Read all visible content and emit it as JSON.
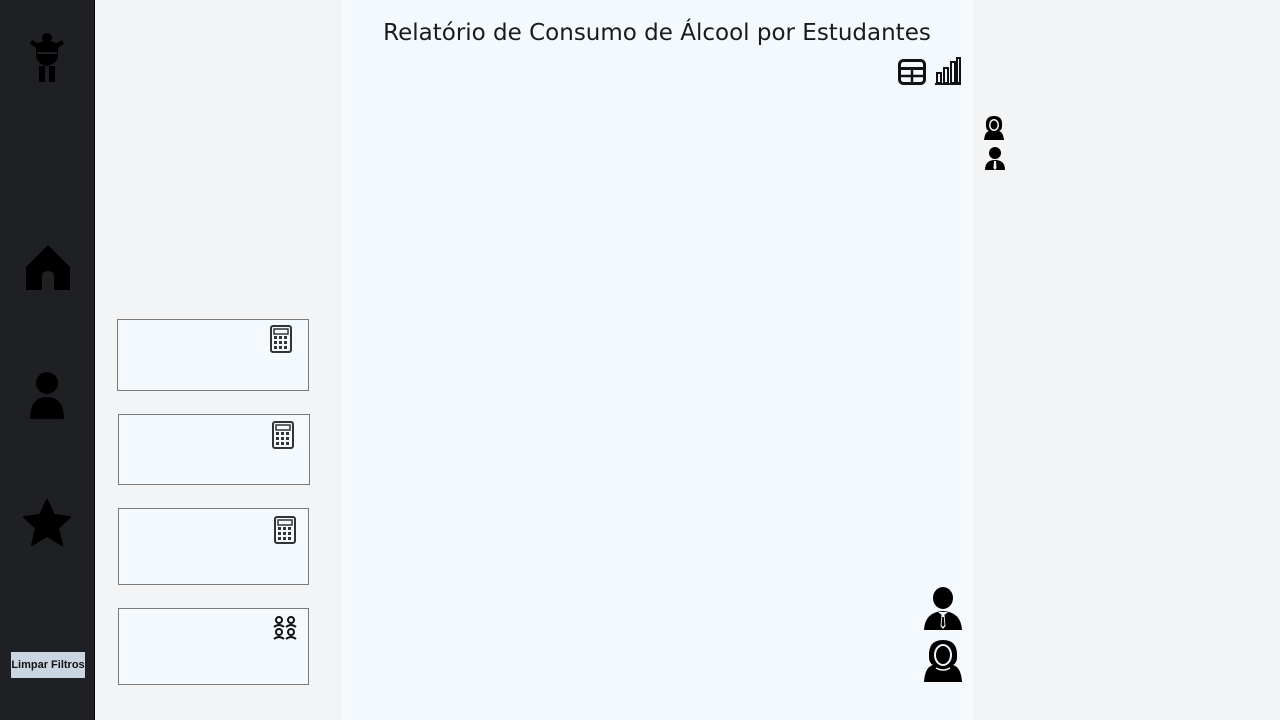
{
  "report": {
    "title": "Relatório de Consumo de Álcool por Estudantes"
  },
  "sidebar": {
    "icons": [
      "logo-icon",
      "home-icon",
      "person-icon",
      "star-icon"
    ],
    "clear_filters_label": "Limpar Filtros"
  },
  "toolbar": {
    "icons": [
      "table-icon",
      "bar-chart-icon"
    ]
  },
  "cards": [
    {
      "icon": "calculator-icon"
    },
    {
      "icon": "calculator-icon"
    },
    {
      "icon": "calculator-icon"
    },
    {
      "icon": "group-icon"
    }
  ],
  "legend": {
    "icons": [
      "female-icon",
      "male-icon"
    ]
  },
  "colors": {
    "sidebar_bg": "#1f2023",
    "panel_bg": "#f2f4f6",
    "main_bg": "#f4f9fd",
    "button_bg": "#c9d6e1"
  }
}
